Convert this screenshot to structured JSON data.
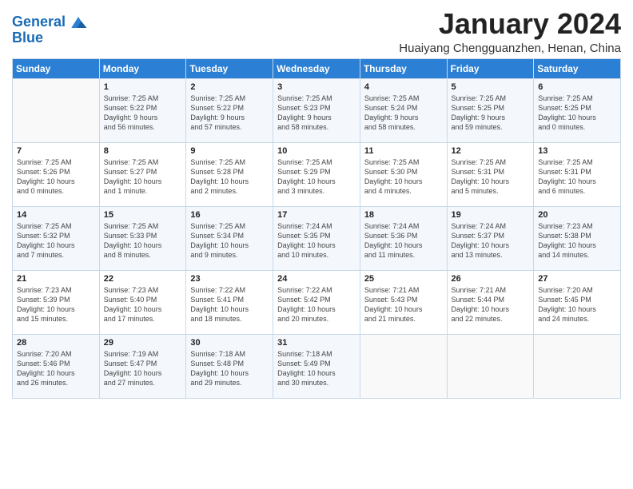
{
  "logo": {
    "line1": "General",
    "line2": "Blue"
  },
  "title": "January 2024",
  "subtitle": "Huaiyang Chengguanzhen, Henan, China",
  "days_header": [
    "Sunday",
    "Monday",
    "Tuesday",
    "Wednesday",
    "Thursday",
    "Friday",
    "Saturday"
  ],
  "weeks": [
    [
      {
        "num": "",
        "info": ""
      },
      {
        "num": "1",
        "info": "Sunrise: 7:25 AM\nSunset: 5:22 PM\nDaylight: 9 hours\nand 56 minutes."
      },
      {
        "num": "2",
        "info": "Sunrise: 7:25 AM\nSunset: 5:22 PM\nDaylight: 9 hours\nand 57 minutes."
      },
      {
        "num": "3",
        "info": "Sunrise: 7:25 AM\nSunset: 5:23 PM\nDaylight: 9 hours\nand 58 minutes."
      },
      {
        "num": "4",
        "info": "Sunrise: 7:25 AM\nSunset: 5:24 PM\nDaylight: 9 hours\nand 58 minutes."
      },
      {
        "num": "5",
        "info": "Sunrise: 7:25 AM\nSunset: 5:25 PM\nDaylight: 9 hours\nand 59 minutes."
      },
      {
        "num": "6",
        "info": "Sunrise: 7:25 AM\nSunset: 5:25 PM\nDaylight: 10 hours\nand 0 minutes."
      }
    ],
    [
      {
        "num": "7",
        "info": "Sunrise: 7:25 AM\nSunset: 5:26 PM\nDaylight: 10 hours\nand 0 minutes."
      },
      {
        "num": "8",
        "info": "Sunrise: 7:25 AM\nSunset: 5:27 PM\nDaylight: 10 hours\nand 1 minute."
      },
      {
        "num": "9",
        "info": "Sunrise: 7:25 AM\nSunset: 5:28 PM\nDaylight: 10 hours\nand 2 minutes."
      },
      {
        "num": "10",
        "info": "Sunrise: 7:25 AM\nSunset: 5:29 PM\nDaylight: 10 hours\nand 3 minutes."
      },
      {
        "num": "11",
        "info": "Sunrise: 7:25 AM\nSunset: 5:30 PM\nDaylight: 10 hours\nand 4 minutes."
      },
      {
        "num": "12",
        "info": "Sunrise: 7:25 AM\nSunset: 5:31 PM\nDaylight: 10 hours\nand 5 minutes."
      },
      {
        "num": "13",
        "info": "Sunrise: 7:25 AM\nSunset: 5:31 PM\nDaylight: 10 hours\nand 6 minutes."
      }
    ],
    [
      {
        "num": "14",
        "info": "Sunrise: 7:25 AM\nSunset: 5:32 PM\nDaylight: 10 hours\nand 7 minutes."
      },
      {
        "num": "15",
        "info": "Sunrise: 7:25 AM\nSunset: 5:33 PM\nDaylight: 10 hours\nand 8 minutes."
      },
      {
        "num": "16",
        "info": "Sunrise: 7:25 AM\nSunset: 5:34 PM\nDaylight: 10 hours\nand 9 minutes."
      },
      {
        "num": "17",
        "info": "Sunrise: 7:24 AM\nSunset: 5:35 PM\nDaylight: 10 hours\nand 10 minutes."
      },
      {
        "num": "18",
        "info": "Sunrise: 7:24 AM\nSunset: 5:36 PM\nDaylight: 10 hours\nand 11 minutes."
      },
      {
        "num": "19",
        "info": "Sunrise: 7:24 AM\nSunset: 5:37 PM\nDaylight: 10 hours\nand 13 minutes."
      },
      {
        "num": "20",
        "info": "Sunrise: 7:23 AM\nSunset: 5:38 PM\nDaylight: 10 hours\nand 14 minutes."
      }
    ],
    [
      {
        "num": "21",
        "info": "Sunrise: 7:23 AM\nSunset: 5:39 PM\nDaylight: 10 hours\nand 15 minutes."
      },
      {
        "num": "22",
        "info": "Sunrise: 7:23 AM\nSunset: 5:40 PM\nDaylight: 10 hours\nand 17 minutes."
      },
      {
        "num": "23",
        "info": "Sunrise: 7:22 AM\nSunset: 5:41 PM\nDaylight: 10 hours\nand 18 minutes."
      },
      {
        "num": "24",
        "info": "Sunrise: 7:22 AM\nSunset: 5:42 PM\nDaylight: 10 hours\nand 20 minutes."
      },
      {
        "num": "25",
        "info": "Sunrise: 7:21 AM\nSunset: 5:43 PM\nDaylight: 10 hours\nand 21 minutes."
      },
      {
        "num": "26",
        "info": "Sunrise: 7:21 AM\nSunset: 5:44 PM\nDaylight: 10 hours\nand 22 minutes."
      },
      {
        "num": "27",
        "info": "Sunrise: 7:20 AM\nSunset: 5:45 PM\nDaylight: 10 hours\nand 24 minutes."
      }
    ],
    [
      {
        "num": "28",
        "info": "Sunrise: 7:20 AM\nSunset: 5:46 PM\nDaylight: 10 hours\nand 26 minutes."
      },
      {
        "num": "29",
        "info": "Sunrise: 7:19 AM\nSunset: 5:47 PM\nDaylight: 10 hours\nand 27 minutes."
      },
      {
        "num": "30",
        "info": "Sunrise: 7:18 AM\nSunset: 5:48 PM\nDaylight: 10 hours\nand 29 minutes."
      },
      {
        "num": "31",
        "info": "Sunrise: 7:18 AM\nSunset: 5:49 PM\nDaylight: 10 hours\nand 30 minutes."
      },
      {
        "num": "",
        "info": ""
      },
      {
        "num": "",
        "info": ""
      },
      {
        "num": "",
        "info": ""
      }
    ]
  ]
}
